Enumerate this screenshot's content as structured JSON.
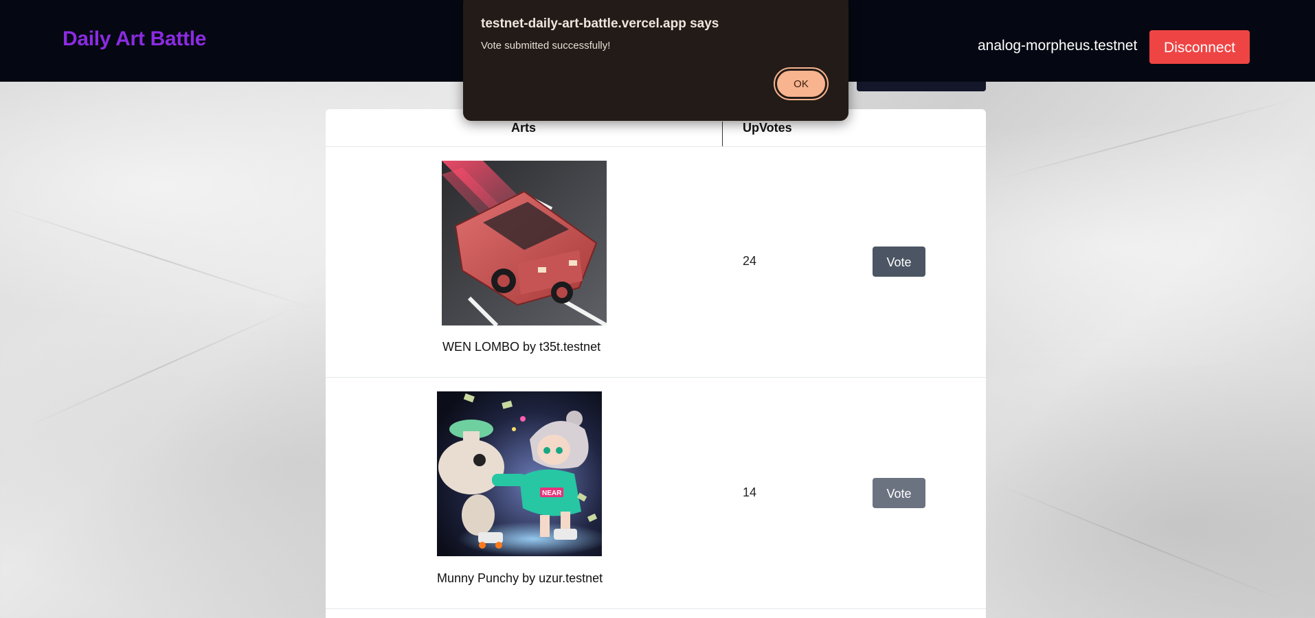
{
  "header": {
    "brand": "Daily Art Battle",
    "account": "analog-morpheus.testnet",
    "disconnect_label": "Disconnect"
  },
  "table": {
    "columns": [
      "Arts",
      "UpVotes"
    ],
    "rows": [
      {
        "title": "WEN LOMBO by t35t.testnet",
        "upvotes": "24",
        "vote_label": "Vote",
        "image": "red-lamborghini-artwork"
      },
      {
        "title": "Munny Punchy by uzur.testnet",
        "upvotes": "14",
        "vote_label": "Vote",
        "image": "anime-girl-punching-artwork"
      }
    ]
  },
  "dialog": {
    "title": "testnet-daily-art-battle.vercel.app says",
    "message": "Vote submitted successfully!",
    "ok_label": "OK"
  },
  "colors": {
    "header_bg": "#050812",
    "brand": "#8b2be2",
    "disconnect_bg": "#ef4444",
    "vote_bg_1": "#4b5563",
    "vote_bg_2": "#6b7280",
    "dialog_bg": "#231b17",
    "dialog_ok_bg": "#f7b48f"
  }
}
